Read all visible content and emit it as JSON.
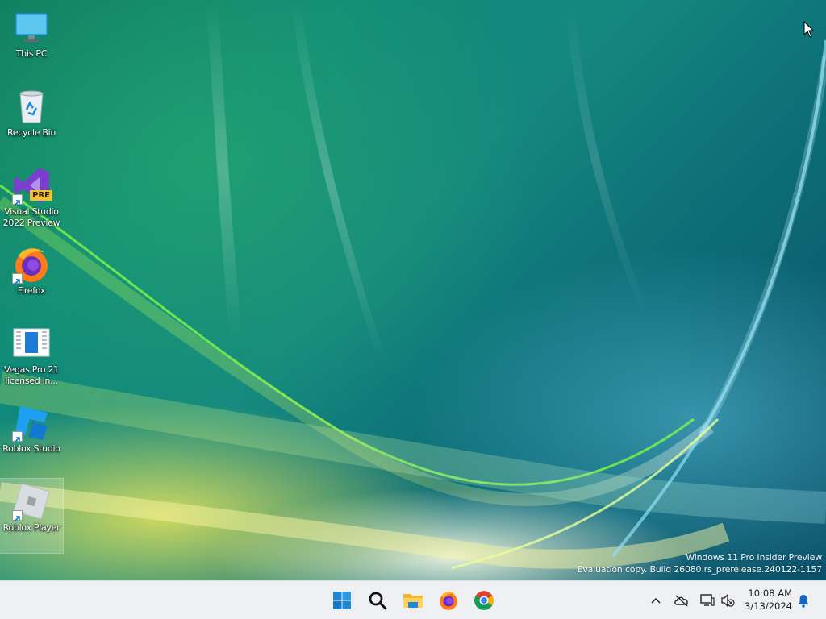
{
  "desktop": {
    "icons": [
      {
        "label": "This PC",
        "icon": "computer-icon"
      },
      {
        "label": "Recycle Bin",
        "icon": "recycle-bin-icon"
      },
      {
        "label": "Visual Studio 2022 Preview",
        "icon": "visual-studio-icon",
        "badge": "PRE"
      },
      {
        "label": "Firefox",
        "icon": "firefox-icon"
      },
      {
        "label": "Vegas Pro 21 licensed in...",
        "icon": "vegas-pro-icon"
      },
      {
        "label": "Roblox Studio",
        "icon": "roblox-studio-icon"
      },
      {
        "label": "Roblox Player",
        "icon": "roblox-player-icon"
      }
    ],
    "watermark": {
      "line1": "Windows 11 Pro Insider Preview",
      "line2": "Evaluation copy. Build 26080.rs_prerelease.240122-1157"
    }
  },
  "taskbar": {
    "apps": [
      {
        "name": "Start",
        "icon": "windows-start-icon"
      },
      {
        "name": "Search",
        "icon": "search-icon"
      },
      {
        "name": "File Explorer",
        "icon": "file-explorer-icon"
      },
      {
        "name": "Firefox",
        "icon": "firefox-icon"
      },
      {
        "name": "Chrome",
        "icon": "chrome-icon"
      }
    ],
    "tray": {
      "icons": [
        "chevron-up-icon",
        "onedrive-offline-icon",
        "network-icon",
        "volume-muted-icon",
        "notification-bell-icon"
      ],
      "time": "10:08 AM",
      "date": "3/13/2024"
    }
  },
  "colors": {
    "taskbar_bg": "#eef0f3",
    "windows_blue": "#1e88d8",
    "desktop_teal": "#0f8a78"
  }
}
